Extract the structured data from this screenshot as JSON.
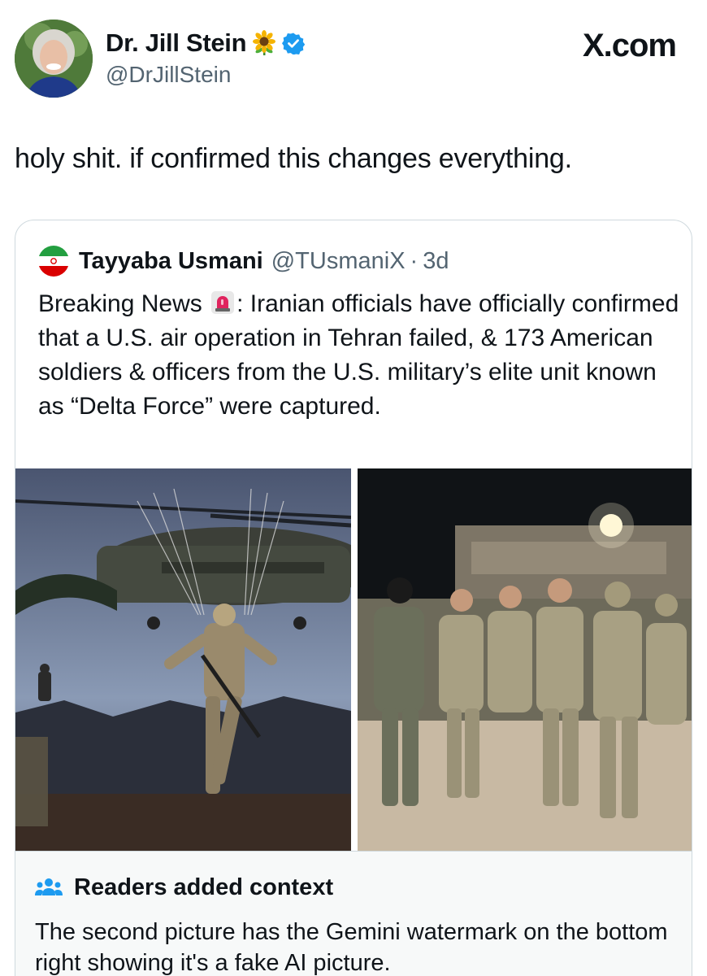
{
  "author": {
    "display_name": "Dr. Jill Stein",
    "name_emoji": "sunflower-icon",
    "verified": true,
    "handle": "@DrJillStein"
  },
  "site": "X.com",
  "tweet": {
    "text": "holy shit. if confirmed this changes everything."
  },
  "quoted_tweet": {
    "flag": "iran-flag-icon",
    "display_name": "Tayyaba Usmani",
    "handle": "@TUsmaniX",
    "time": "3d",
    "text_prefix": "Breaking News",
    "text_rest": ": Iranian officials have officially confirmed that a U.S. air operation in Tehran failed, & 173 American soldiers & officers from the U.S. military’s elite unit known as “Delta Force” were captured.",
    "images": [
      "paratrooper-helicopter-photo",
      "soldiers-marching-photo"
    ]
  },
  "community_note": {
    "title": "Readers added context",
    "text": "The second picture has the Gemini watermark on the bottom right showing it's a fake AI picture."
  },
  "colors": {
    "text": "#0f1419",
    "secondary": "#536471",
    "border": "#cfd9de",
    "verified_blue": "#1d9bf0",
    "notes_bg": "#f7f9f9"
  }
}
